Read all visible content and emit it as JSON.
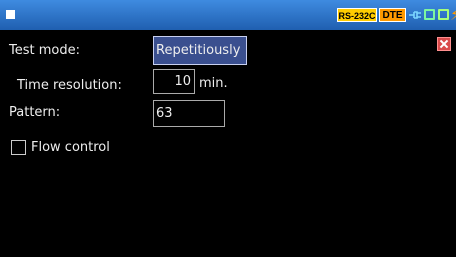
{
  "statusbar": {
    "interface_badge": "RS-232C",
    "mode_badge": "DTE"
  },
  "form": {
    "test_mode": {
      "label": "Test mode:",
      "value": "Repetitiously"
    },
    "time_resolution": {
      "label": "Time resolution:",
      "value": "10",
      "unit": "min."
    },
    "pattern": {
      "label": "Pattern:",
      "value": "63"
    },
    "flow_control": {
      "label": "Flow control",
      "checked": false
    }
  },
  "colors": {
    "titlebar": "#2f72c8",
    "selected_field": "#3a4f8f",
    "close": "#d94a4a",
    "badge_interface": "#ffcc00",
    "badge_mode": "#ff9900"
  },
  "icons": [
    "window-icon",
    "plug-icon",
    "port-icon",
    "device-icon",
    "battery-bolt-icon",
    "close-icon"
  ]
}
